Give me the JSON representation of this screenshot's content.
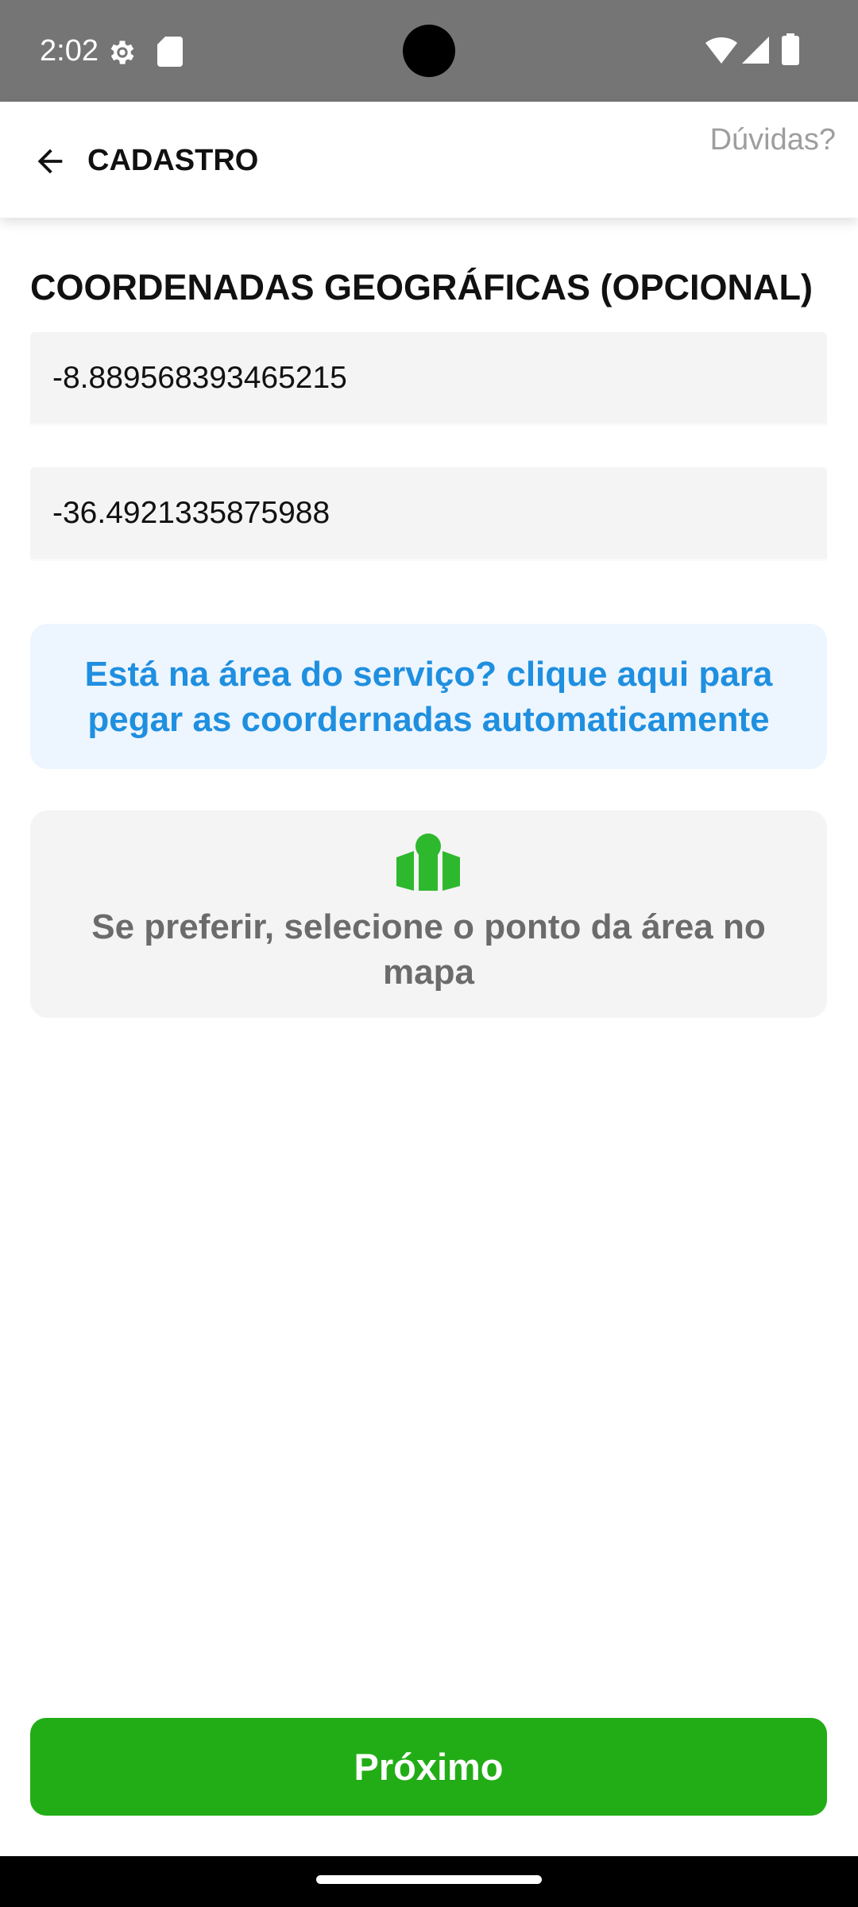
{
  "status_bar": {
    "time": "2:02",
    "icons": [
      "settings-gear-icon",
      "sd-card-icon",
      "wifi-icon",
      "signal-icon",
      "battery-icon"
    ]
  },
  "header": {
    "title": "CADASTRO",
    "back_icon": "arrow-left-icon",
    "help_label": "Dúvidas?"
  },
  "section": {
    "title": "COORDENADAS GEOGRÁFICAS (OPCIONAL)"
  },
  "fields": {
    "latitude": "-8.889568393465215",
    "longitude": "-36.4921335875988"
  },
  "auto_coords": {
    "label": "Está na área do serviço? clique aqui para pegar as coordernadas automaticamente"
  },
  "map_select": {
    "icon": "map-pin-icon",
    "label": "Se preferir, selecione o ponto da área no mapa"
  },
  "next_button": {
    "label": "Próximo"
  },
  "colors": {
    "accent_green": "#22ad16",
    "link_blue": "#1f8fe0",
    "link_bg": "#edf5fe",
    "field_bg": "#f4f4f4",
    "status_bar": "#757575"
  }
}
